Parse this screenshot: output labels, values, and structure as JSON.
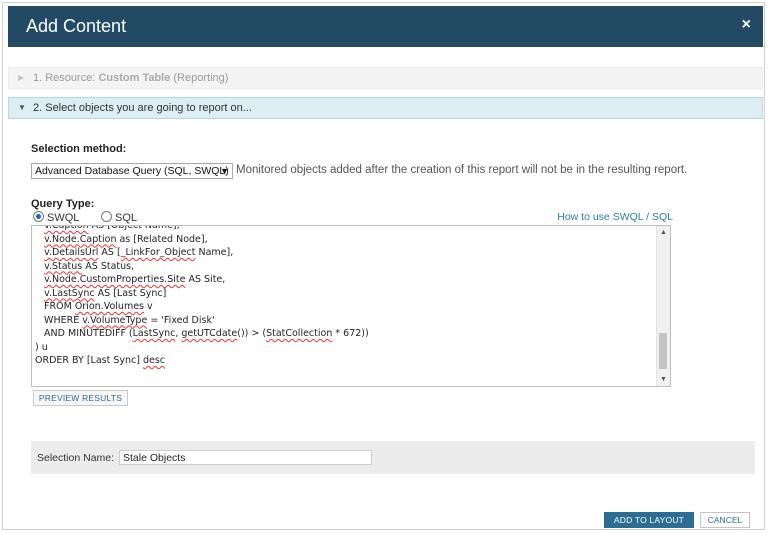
{
  "dialog": {
    "title": "Add Content",
    "close_symbol": "×"
  },
  "steps": [
    {
      "number_label": "1. Resource:",
      "name": "Custom Table",
      "suffix": "(Reporting)"
    },
    {
      "label": "2. Select objects you are going to report on..."
    }
  ],
  "selection_method": {
    "label": "Selection method:",
    "selected": "Advanced Database Query (SQL, SWQL)",
    "note": "Monitored objects added after the creation of this report will not be in the resulting report."
  },
  "query_type": {
    "label": "Query Type:",
    "options": [
      {
        "label": "SWQL",
        "checked": true
      },
      {
        "label": "SQL",
        "checked": false
      }
    ],
    "help_link": "How to use SWQL / SQL"
  },
  "query_lines": [
    "   v.Caption AS [Object Name],",
    "   v.Node.Caption as [Related Node],",
    "   v.DetailsUrl AS [_LinkFor_Object Name],",
    "   v.Status AS Status,",
    "   v.Node.CustomProperties.Site AS Site,",
    "   v.LastSync AS [Last Sync]",
    "   FROM Orion.Volumes v",
    "   WHERE v.VolumeType = 'Fixed Disk'",
    "   AND MINUTEDIFF (LastSync, getUTCdate()) > (StatCollection * 672))",
    ") u",
    "ORDER BY [Last Sync] desc"
  ],
  "buttons": {
    "preview": "PREVIEW RESULTS",
    "add_to_layout": "ADD TO LAYOUT",
    "cancel": "CANCEL"
  },
  "selection_name": {
    "label": "Selection Name:",
    "value": "Stale Objects"
  },
  "colors": {
    "title_bar": "#234a64",
    "primary_button": "#2c6e93",
    "link": "#2b7ab5"
  }
}
